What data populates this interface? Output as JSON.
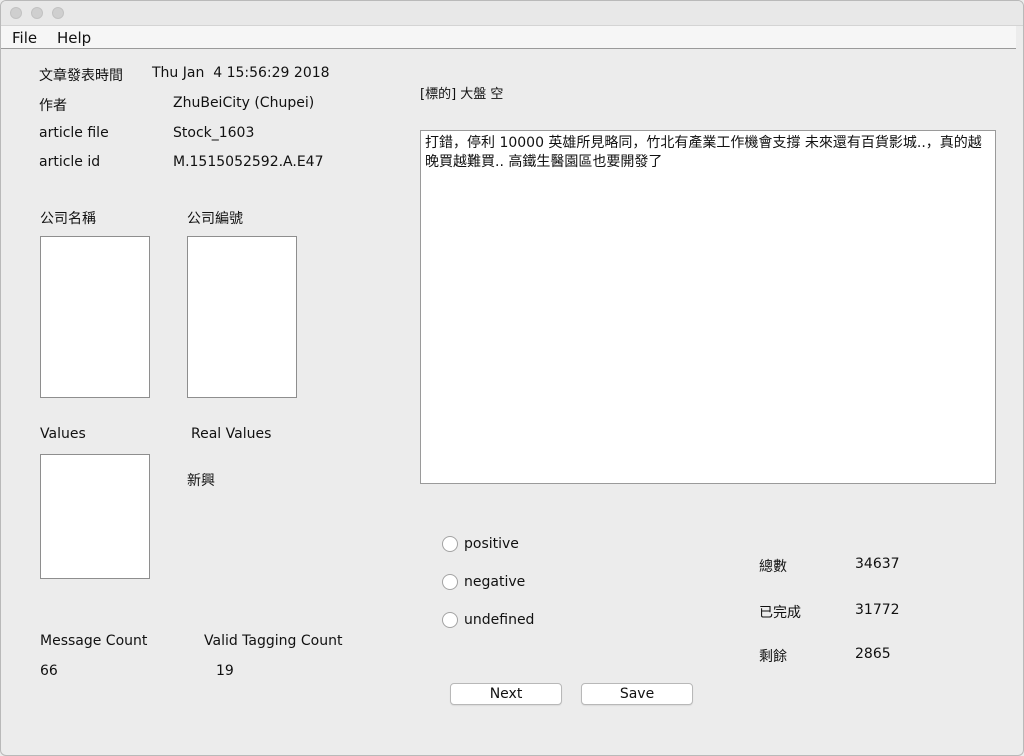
{
  "menu": {
    "file": "File",
    "help": "Help"
  },
  "meta": {
    "post_time_label": "文章發表時間",
    "post_time_value": "Thu Jan  4 15:56:29 2018",
    "author_label": "作者",
    "author_value": "ZhuBeiCity (Chupei)",
    "file_label": "article file",
    "file_value": "Stock_1603",
    "id_label": "article id",
    "id_value": "M.1515052592.A.E47"
  },
  "lists": {
    "company_name_label": "公司名稱",
    "company_code_label": "公司編號",
    "values_label": "Values",
    "real_values_label": "Real Values",
    "real_values_text": "新興"
  },
  "counts": {
    "message_label": "Message Count",
    "message_value": "66",
    "valid_label": "Valid Tagging Count",
    "valid_value": "19"
  },
  "article": {
    "title": "[標的] 大盤 空",
    "body": "打錯，停利 10000 英雄所見略同，竹北有產業工作機會支撐 未來還有百貨影城..，真的越晚買越難買.. 高鐵生醫園區也要開發了"
  },
  "sentiment": {
    "positive": "positive",
    "negative": "negative",
    "undefined": "undefined"
  },
  "stats": {
    "total_label": "總數",
    "total_value": "34637",
    "done_label": "已完成",
    "done_value": "31772",
    "remaining_label": "剩餘",
    "remaining_value": "2865"
  },
  "buttons": {
    "next": "Next",
    "save": "Save"
  }
}
